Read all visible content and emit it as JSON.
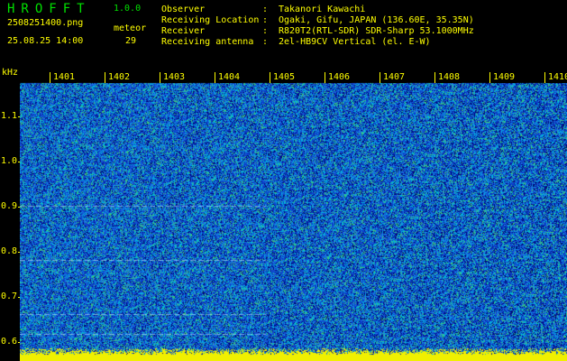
{
  "header": {
    "app_name": "HROFFT",
    "version": "1.0.0",
    "file_name": "2508251400.png",
    "type": "meteor",
    "datetime": "25.08.25 14:00",
    "count": "29"
  },
  "info": [
    {
      "label": "Observer",
      "sep": ":",
      "value": "Takanori Kawachi"
    },
    {
      "label": "Receiving Location",
      "sep": ":",
      "value": "Ogaki, Gifu, JAPAN (136.60E, 35.35N)"
    },
    {
      "label": "Receiver",
      "sep": ":",
      "value": "R820T2(RTL-SDR) SDR-Sharp 53.1000MHz"
    },
    {
      "label": "Receiving antenna",
      "sep": ":",
      "value": "2el-HB9CV Vertical (el. E-W)"
    }
  ],
  "axis": {
    "y_unit": "kHz",
    "x_ticks": [
      "1401",
      "1402",
      "1403",
      "1404",
      "1405",
      "1406",
      "1407",
      "1408",
      "1409",
      "1410"
    ],
    "y_ticks": [
      "1.1",
      "1.0",
      "0.9",
      "0.8",
      "0.7",
      "0.6"
    ]
  },
  "colors": {
    "background": "#000000",
    "text": "#ffff00",
    "title": "#00e000",
    "spectrogram_base": "#0a3ab8",
    "noise_floor": "#ffff00"
  }
}
